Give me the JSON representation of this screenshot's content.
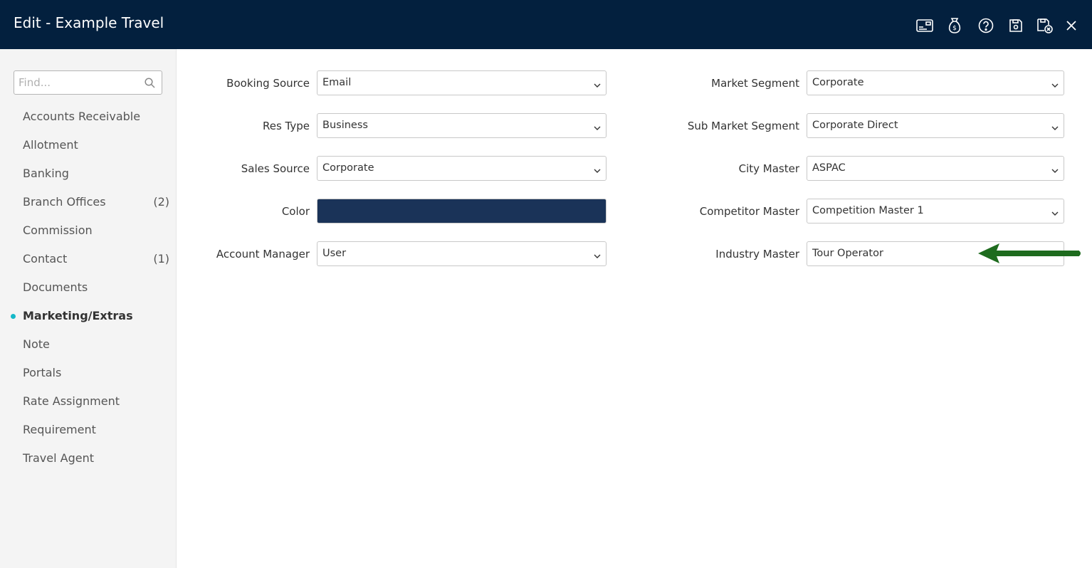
{
  "window": {
    "title": "Edit - Example Travel",
    "toolbar_icons": [
      "card-icon",
      "money-bag-icon",
      "help-icon",
      "save-icon",
      "save-close-icon",
      "close-icon"
    ]
  },
  "sidebar": {
    "search_placeholder": "Find...",
    "items": [
      {
        "label": "Accounts Receivable",
        "count": ""
      },
      {
        "label": "Allotment",
        "count": ""
      },
      {
        "label": "Banking",
        "count": ""
      },
      {
        "label": "Branch Offices",
        "count": "(2)"
      },
      {
        "label": "Commission",
        "count": ""
      },
      {
        "label": "Contact",
        "count": "(1)"
      },
      {
        "label": "Documents",
        "count": ""
      },
      {
        "label": "Marketing/Extras",
        "count": "",
        "active": true
      },
      {
        "label": "Note",
        "count": ""
      },
      {
        "label": "Portals",
        "count": ""
      },
      {
        "label": "Rate Assignment",
        "count": ""
      },
      {
        "label": "Requirement",
        "count": ""
      },
      {
        "label": "Travel Agent",
        "count": ""
      }
    ]
  },
  "form": {
    "booking_source": {
      "label": "Booking Source",
      "value": "Email"
    },
    "res_type": {
      "label": "Res Type",
      "value": "Business"
    },
    "sales_source": {
      "label": "Sales Source",
      "value": "Corporate"
    },
    "color": {
      "label": "Color",
      "value": "#1a3358"
    },
    "account_manager": {
      "label": "Account Manager",
      "value": "User"
    },
    "market_segment": {
      "label": "Market Segment",
      "value": "Corporate"
    },
    "sub_market_segment": {
      "label": "Sub Market Segment",
      "value": "Corporate Direct"
    },
    "city_master": {
      "label": "City Master",
      "value": "ASPAC"
    },
    "competitor_master": {
      "label": "Competitor Master",
      "value": "Competition Master 1"
    },
    "industry_master": {
      "label": "Industry Master",
      "value": "Tour Operator"
    }
  },
  "colors": {
    "titlebar": "#03203e",
    "accent_dot": "#14b8c8",
    "annotation_arrow": "#1e6b1e"
  }
}
